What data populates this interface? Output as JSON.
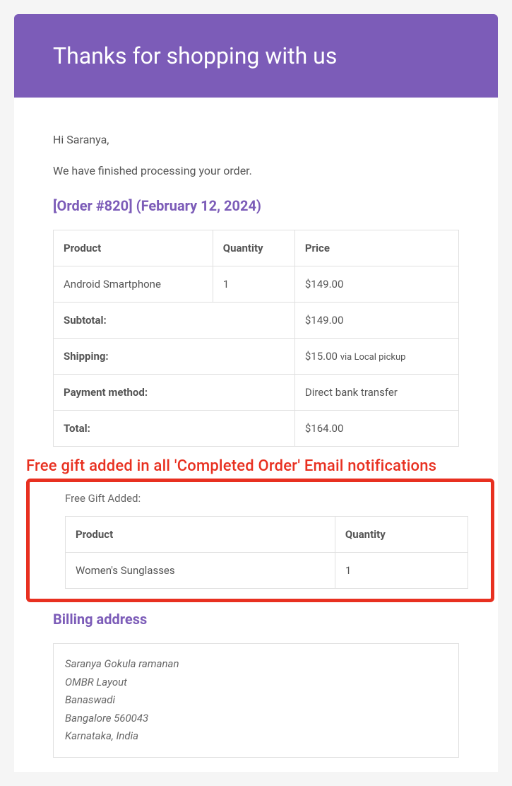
{
  "header": {
    "title": "Thanks for shopping with us"
  },
  "greeting": "Hi Saranya,",
  "processing_text": "We have finished processing your order.",
  "order_heading": "[Order #820] (February 12, 2024)",
  "order_table": {
    "headers": {
      "product": "Product",
      "quantity": "Quantity",
      "price": "Price"
    },
    "items": [
      {
        "product": "Android Smartphone",
        "quantity": "1",
        "price": "$149.00"
      }
    ],
    "totals": {
      "subtotal_label": "Subtotal:",
      "subtotal_value": "$149.00",
      "shipping_label": "Shipping:",
      "shipping_value": "$15.00 ",
      "shipping_via": "via Local pickup",
      "payment_label": "Payment method:",
      "payment_value": "Direct bank transfer",
      "total_label": "Total:",
      "total_value": "$164.00"
    }
  },
  "annotation": "Free gift added in all 'Completed Order' Email notifications",
  "free_gift": {
    "label": "Free Gift Added:",
    "headers": {
      "product": "Product",
      "quantity": "Quantity"
    },
    "items": [
      {
        "product": "Women's Sunglasses",
        "quantity": "1"
      }
    ]
  },
  "billing": {
    "heading": "Billing address",
    "lines": [
      "Saranya Gokula ramanan",
      "OMBR Layout",
      "Banaswadi",
      "Bangalore 560043",
      "Karnataka, India"
    ]
  }
}
